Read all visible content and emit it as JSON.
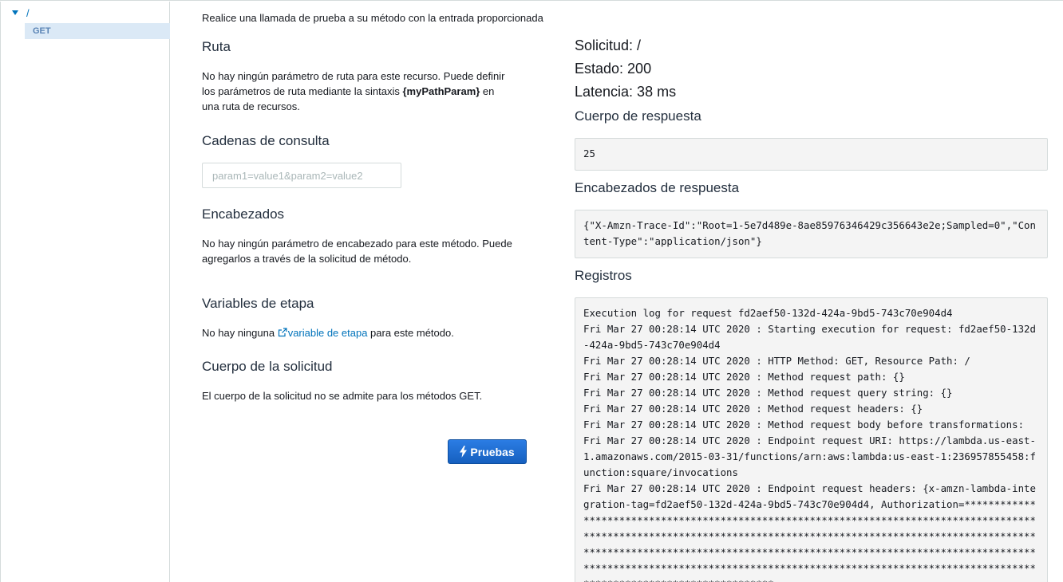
{
  "tree": {
    "root_label": "/",
    "method_label": "GET"
  },
  "left": {
    "intro": "Realice una llamada de prueba a su método con la entrada proporcionada",
    "path": {
      "heading": "Ruta",
      "text_1": "No hay ningún parámetro de ruta para este recurso. Puede definir los parámetros de ruta mediante la sintaxis",
      "text_bold": "{myPathParam}",
      "text_2": " en una ruta de recursos."
    },
    "query": {
      "heading": "Cadenas de consulta",
      "placeholder": "param1=value1&param2=value2"
    },
    "headers": {
      "heading": "Encabezados",
      "text": "No hay ningún parámetro de encabezado para este método. Puede agregarlos a través de la solicitud de método."
    },
    "stage": {
      "heading": "Variables de etapa",
      "text_before": "No hay ninguna ",
      "link": "variable de etapa",
      "text_after": " para este método."
    },
    "body": {
      "heading": "Cuerpo de la solicitud",
      "text": "El cuerpo de la solicitud no se admite para los métodos GET."
    },
    "test_button": "Pruebas"
  },
  "right": {
    "request": "Solicitud: /",
    "status": "Estado: 200",
    "latency": "Latencia: 38 ms",
    "response_body_heading": "Cuerpo de respuesta",
    "response_body": "25",
    "response_headers_heading": "Encabezados de respuesta",
    "response_headers": "{\"X-Amzn-Trace-Id\":\"Root=1-5e7d489e-8ae85976346429c356643e2e;Sampled=0\",\"Content-Type\":\"application/json\"}",
    "logs_heading": "Registros",
    "logs": "Execution log for request fd2aef50-132d-424a-9bd5-743c70e904d4\nFri Mar 27 00:28:14 UTC 2020 : Starting execution for request: fd2aef50-132d-424a-9bd5-743c70e904d4\nFri Mar 27 00:28:14 UTC 2020 : HTTP Method: GET, Resource Path: /\nFri Mar 27 00:28:14 UTC 2020 : Method request path: {}\nFri Mar 27 00:28:14 UTC 2020 : Method request query string: {}\nFri Mar 27 00:28:14 UTC 2020 : Method request headers: {}\nFri Mar 27 00:28:14 UTC 2020 : Method request body before transformations:\nFri Mar 27 00:28:14 UTC 2020 : Endpoint request URI: https://lambda.us-east-1.amazonaws.com/2015-03-31/functions/arn:aws:lambda:us-east-1:236957855458:function:square/invocations\nFri Mar 27 00:28:14 UTC 2020 : Endpoint request headers: {x-amzn-lambda-integration-tag=fd2aef50-132d-424a-9bd5-743c70e904d4, Authorization=************************************************************************************************************************************************************************************************************************************************************************************************************************************************************"
  },
  "colors": {
    "accent": "#0073bb",
    "button": "#1f6fd6",
    "code_bg": "#f4f4f4",
    "selected_row": "#dbe9f6"
  }
}
